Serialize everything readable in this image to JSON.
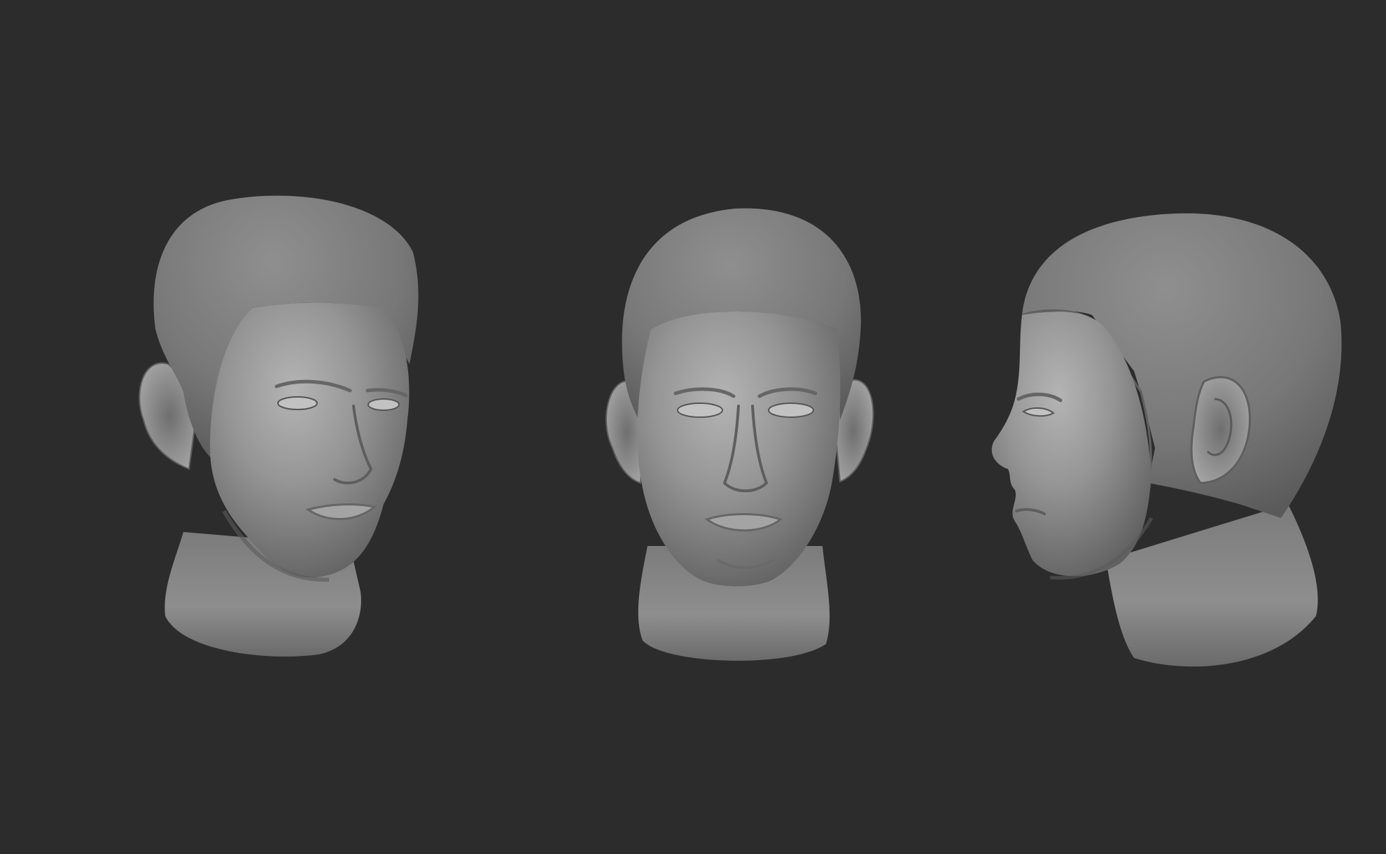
{
  "viewport": {
    "background": "#2c2c2c",
    "material_color": "#8c8c8c"
  },
  "models": [
    {
      "id": "head-three-quarter",
      "icon": "sculpted-head-three-quarter-view"
    },
    {
      "id": "head-front",
      "icon": "sculpted-head-front-view"
    },
    {
      "id": "head-profile",
      "icon": "sculpted-head-profile-view"
    }
  ]
}
